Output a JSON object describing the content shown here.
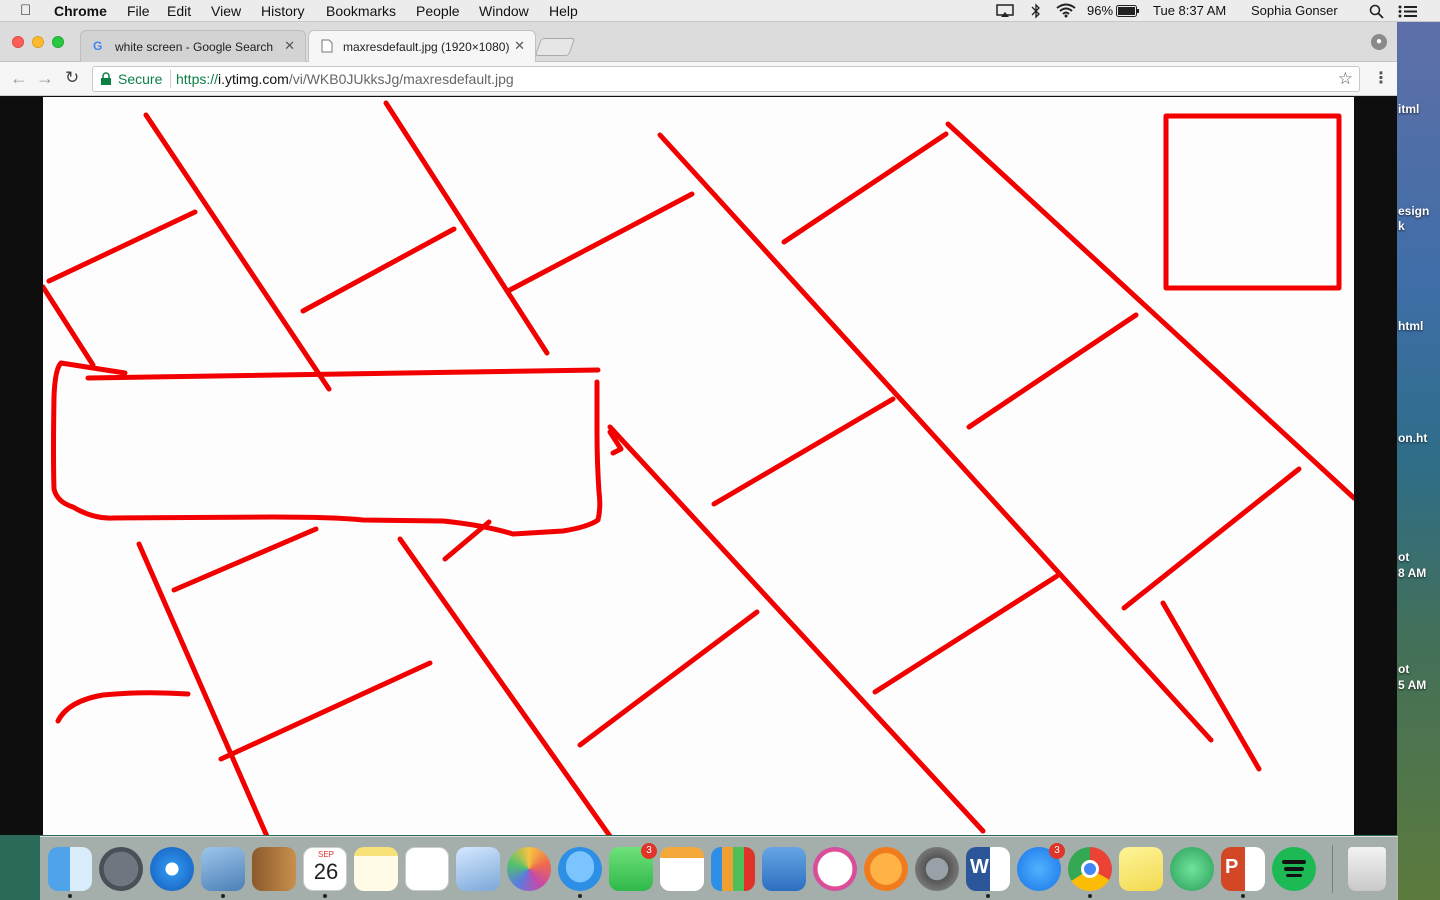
{
  "menubar": {
    "app_name": "Chrome",
    "items": [
      "File",
      "Edit",
      "View",
      "History",
      "Bookmarks",
      "People",
      "Window",
      "Help"
    ],
    "battery": "96%",
    "clock": "Tue 8:37 AM",
    "user": "Sophia Gonser"
  },
  "desktop": {
    "labels": [
      "itml",
      "esign",
      "k",
      "html",
      "on.ht",
      "ot",
      "8 AM",
      "ot",
      "5 AM"
    ]
  },
  "browser": {
    "tabs": [
      {
        "title": "white screen - Google Search",
        "icon": "google-icon",
        "active": false
      },
      {
        "title": "maxresdefault.jpg (1920×1080)",
        "icon": "page-icon",
        "active": true
      }
    ],
    "address": {
      "secure_label": "Secure",
      "scheme": "https://",
      "host": "i.ytimg.com",
      "path": "/vi/WKB0JUkksJg/maxresdefault.jpg"
    }
  },
  "drawing": {
    "stroke_color": "#f20000",
    "background": "#fdfdfd"
  },
  "dock": {
    "apps": [
      {
        "name": "Finder",
        "icon": "finder-icon",
        "running": true
      },
      {
        "name": "Launchpad",
        "icon": "launchpad-icon",
        "running": false
      },
      {
        "name": "Safari",
        "icon": "safari-icon",
        "running": false
      },
      {
        "name": "Mail",
        "icon": "mail-icon",
        "running": true
      },
      {
        "name": "Contacts",
        "icon": "contacts-icon",
        "running": false
      },
      {
        "name": "Calendar",
        "icon": "calendar-icon",
        "running": true,
        "month": "SEP",
        "day": "26"
      },
      {
        "name": "Notes",
        "icon": "notes-icon",
        "running": false
      },
      {
        "name": "Reminders",
        "icon": "reminders-icon",
        "running": false
      },
      {
        "name": "Preview",
        "icon": "preview-icon",
        "running": false
      },
      {
        "name": "Photos",
        "icon": "photos-icon",
        "running": false
      },
      {
        "name": "Messages",
        "icon": "messages-icon",
        "running": true
      },
      {
        "name": "FaceTime",
        "icon": "facetime-icon",
        "running": false,
        "badge": "3"
      },
      {
        "name": "Pages",
        "icon": "pages-icon",
        "running": false
      },
      {
        "name": "Numbers",
        "icon": "numbers-icon",
        "running": false
      },
      {
        "name": "Keynote",
        "icon": "keynote-icon",
        "running": false
      },
      {
        "name": "iTunes",
        "icon": "itunes-icon",
        "running": false
      },
      {
        "name": "iBooks",
        "icon": "ibooks-icon",
        "running": false
      },
      {
        "name": "System Preferences",
        "icon": "system-preferences-icon",
        "running": false
      },
      {
        "name": "Microsoft Word",
        "icon": "word-icon",
        "running": true,
        "letter": "W"
      },
      {
        "name": "App Store",
        "icon": "app-store-icon",
        "running": false,
        "badge": "3"
      },
      {
        "name": "Google Chrome",
        "icon": "chrome-icon",
        "running": true
      },
      {
        "name": "Stickies",
        "icon": "stickies-icon",
        "running": false
      },
      {
        "name": "Atom",
        "icon": "atom-icon",
        "running": false
      },
      {
        "name": "Microsoft PowerPoint",
        "icon": "powerpoint-icon",
        "running": true,
        "letter": "P"
      },
      {
        "name": "Spotify",
        "icon": "spotify-icon",
        "running": false
      },
      {
        "name": "Trash",
        "icon": "trash-icon",
        "running": false
      }
    ]
  }
}
